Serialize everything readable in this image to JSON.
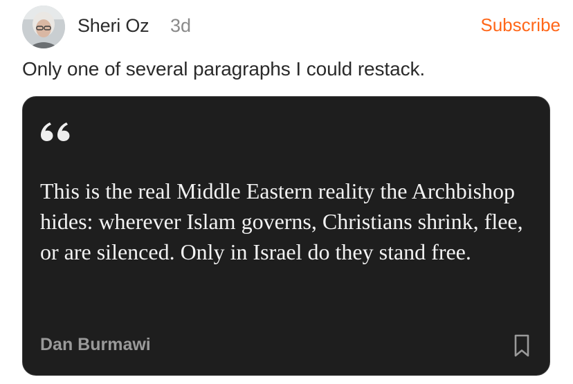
{
  "header": {
    "author_name": "Sheri Oz",
    "timestamp": "3d",
    "subscribe_label": "Subscribe",
    "avatar_icon": "avatar-photo"
  },
  "post": {
    "text": "Only one of several paragraphs I could restack."
  },
  "quote_card": {
    "quote_icon": "quote-mark-icon",
    "quote_text": "This is the real Middle Eastern reality the Archbishop hides: wherever Islam governs, Christians shrink, flee, or are silenced. Only in Israel do they stand free.",
    "source_author": "Dan Burmawi",
    "bookmark_icon": "bookmark-icon"
  },
  "colors": {
    "accent": "#ff6719",
    "card_bg": "#1e1e1e",
    "card_text": "#f2f2f2",
    "muted_text": "#9a9a9a"
  }
}
